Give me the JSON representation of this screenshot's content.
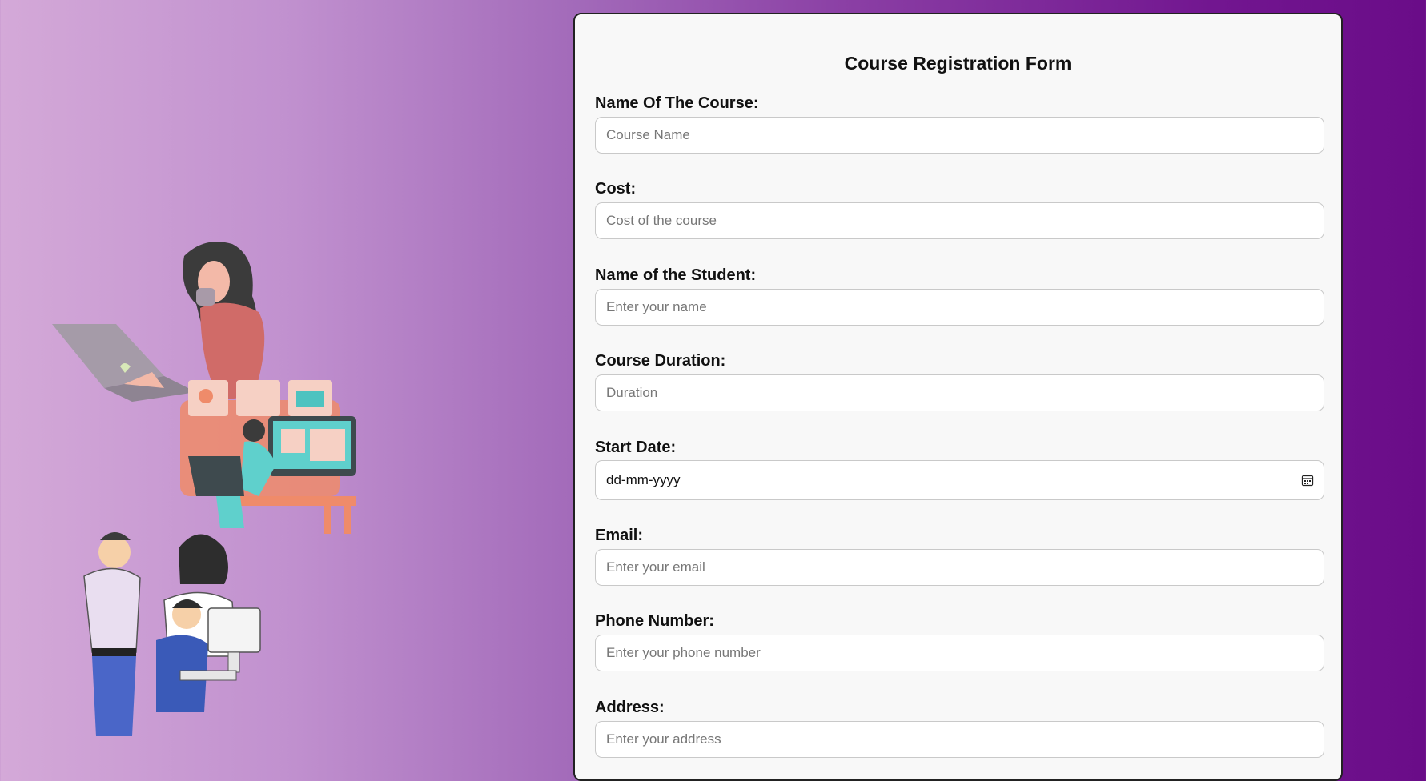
{
  "form": {
    "title": "Course Registration Form",
    "fields": [
      {
        "label": "Name Of The Course:",
        "placeholder": "Course Name"
      },
      {
        "label": "Cost:",
        "placeholder": "Cost of the course"
      },
      {
        "label": "Name of the Student:",
        "placeholder": "Enter your name"
      },
      {
        "label": "Course Duration:",
        "placeholder": "Duration"
      },
      {
        "label": "Start Date:",
        "placeholder": "dd-mm-yyyy"
      },
      {
        "label": "Email:",
        "placeholder": "Enter your email"
      },
      {
        "label": "Phone Number:",
        "placeholder": "Enter your phone number"
      },
      {
        "label": "Address:",
        "placeholder": "Enter your address"
      }
    ]
  },
  "colors": {
    "background_start": "#d4a9d8",
    "background_end": "#6a0c88",
    "card_background": "#f8f8f8"
  },
  "icons": {
    "date_picker": "calendar-icon",
    "illustration": "people-working-on-computers-illustration"
  }
}
